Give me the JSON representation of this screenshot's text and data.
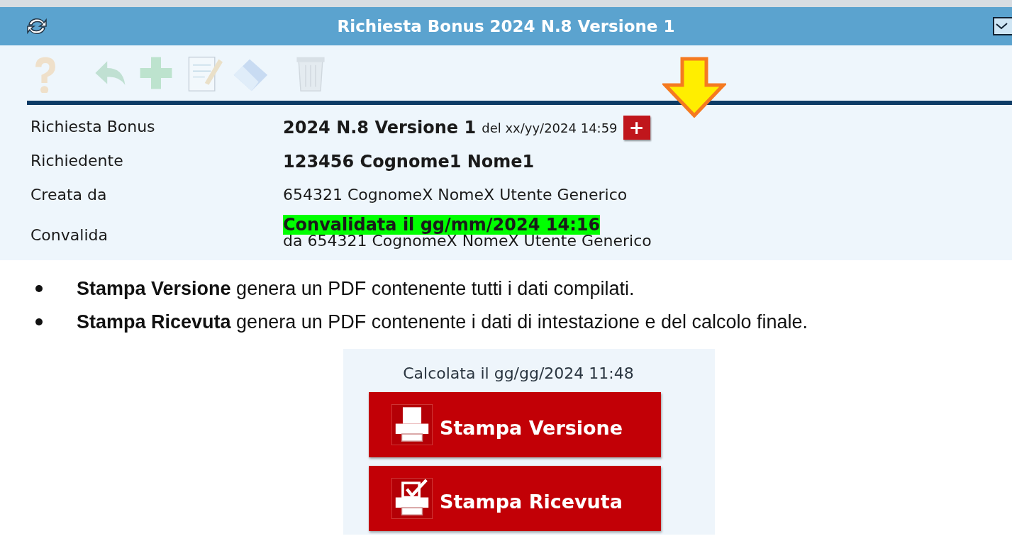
{
  "window": {
    "title": "Richiesta Bonus 2024 N.8 Versione 1"
  },
  "toolbar": [
    {
      "kind": "help",
      "disabled": true
    },
    {
      "kind": "undo",
      "disabled": true
    },
    {
      "kind": "add",
      "disabled": true
    },
    {
      "kind": "edit",
      "disabled": true
    },
    {
      "kind": "erase",
      "disabled": true
    },
    {
      "kind": "delete",
      "disabled": true
    }
  ],
  "details": [
    {
      "label": "Richiesta Bonus",
      "kind": "version",
      "value": "2024 N.8 Versione 1",
      "note": "del xx/yy/2024 14:59",
      "button": "+"
    },
    {
      "label": "Richiedente",
      "kind": "bold",
      "value": "123456 Cognome1 Nome1"
    },
    {
      "label": "Creata da",
      "kind": "plain",
      "value": "654321 CognomeX NomeX Utente Generico"
    },
    {
      "label": "Convalida",
      "kind": "status",
      "value": "Convalidata il gg/mm/2024 14:16",
      "note": "da 654321 CognomeX NomeX Utente Generico"
    }
  ],
  "notes": [
    "**Stampa Versione** genera un PDF contenente tutti i dati compilati.",
    "**Stampa Ricevuta** genera un PDF contenente i dati di intestazione e del calcolo finale."
  ],
  "print_panel": {
    "calculated": "Calcolata il gg/gg/2024 11:48",
    "buttons": [
      {
        "label": "Stampa Versione",
        "kind": "print"
      },
      {
        "label": "Stampa Ricevuta",
        "kind": "receipt"
      }
    ]
  }
}
